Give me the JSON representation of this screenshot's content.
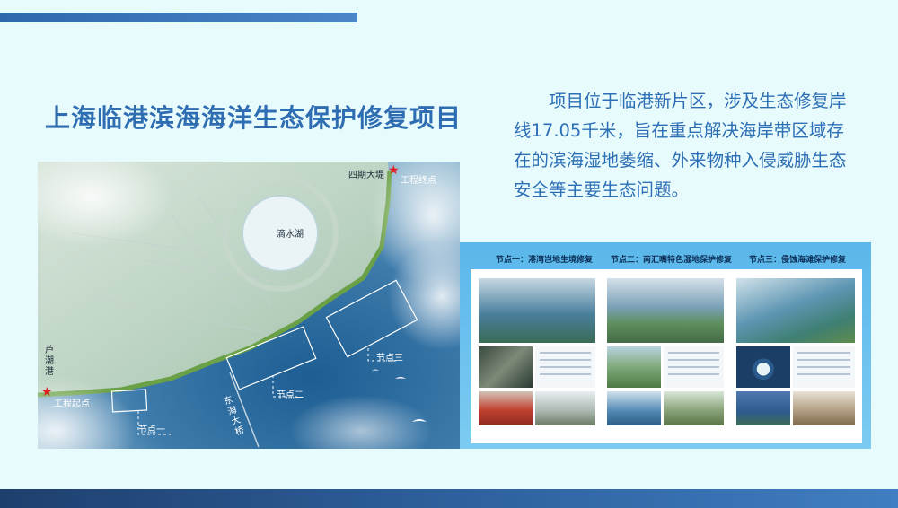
{
  "title": "上海临港滨海海洋生态保护修复项目",
  "description": "项目位于临港新片区，涉及生态修复岸线17.05千米，旨在重点解决海岸带区域存在的滨海湿地萎缩、外来物种入侵威胁生态安全等主要生态问题。",
  "map": {
    "labels": {
      "phase4_dike": "四期大堤",
      "project_end": "工程终点",
      "dishui_lake": "滴水湖",
      "luchao_port": "芦潮港",
      "project_start": "工程起点",
      "node1": "节点一",
      "node2": "节点二",
      "node3": "节点三",
      "donghai_bridge": "东海大桥"
    }
  },
  "panel": {
    "node_titles": [
      "节点一：港湾岂地生境修复",
      "节点二：南汇嘴特色湿地保护修复",
      "节点三：侵蚀海滩保护修复"
    ]
  },
  "colors": {
    "title_blue": "#2e6db1",
    "bar_blue": "#2f67ad",
    "marker_red": "#e02020"
  }
}
